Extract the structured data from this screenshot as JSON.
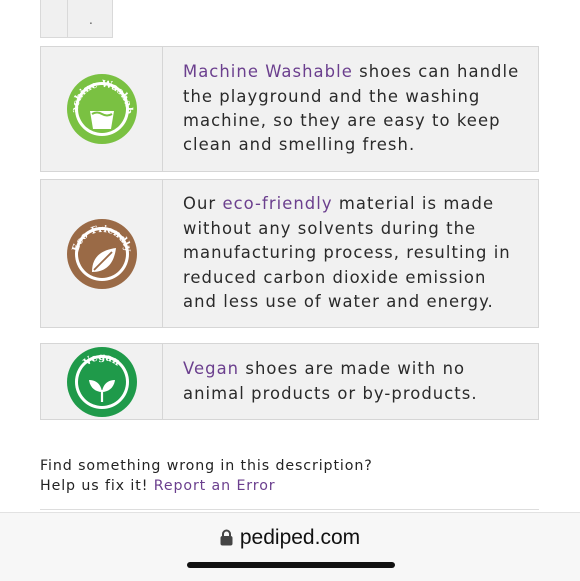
{
  "top_stub": {
    "dot": "."
  },
  "features": [
    {
      "badge_text": "Machine Washable",
      "badge_color": "#7ac142",
      "icon": "washing-basin-icon",
      "highlight": "Machine Washable",
      "body": " shoes can handle the playground and the washing machine, so they are easy to keep clean and smelling fresh."
    },
    {
      "badge_text": "Eco-Friendly",
      "badge_color": "#9a6a46",
      "icon": "leaf-icon",
      "intro": "Our ",
      "highlight": "eco-friendly",
      "body": " material is made without any solvents during the manufacturing process, resulting in reduced carbon dioxide emission and less use of water and energy."
    },
    {
      "badge_text": "Vegan",
      "badge_color": "#1f9a4a",
      "icon": "sprout-icon",
      "highlight": "Vegan",
      "body": " shoes are made with no animal products or by-products."
    }
  ],
  "report": {
    "line1": "Find something wrong in this description?",
    "line2": "Help us fix it! ",
    "link": "Report an Error"
  },
  "browser": {
    "domain": "pediped.com",
    "lock_icon": "lock-icon"
  }
}
